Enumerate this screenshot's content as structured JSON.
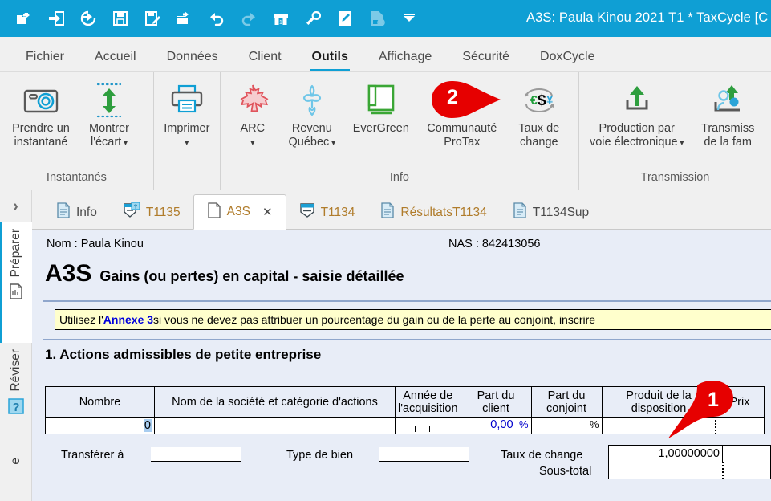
{
  "titlebar": {
    "title": "A3S: Paula Kinou 2021 T1 * TaxCycle [C",
    "quick_access": [
      {
        "name": "open-folder-icon",
        "label": "Ouvrir",
        "disabled": false
      },
      {
        "name": "import-icon",
        "label": "Importer",
        "disabled": false
      },
      {
        "name": "restore-icon",
        "label": "Restaurer",
        "disabled": false
      },
      {
        "name": "save-icon",
        "label": "Enregistrer",
        "disabled": false
      },
      {
        "name": "save-as-icon",
        "label": "Enregistrer sous",
        "disabled": false
      },
      {
        "name": "folder-open-2-icon",
        "label": "Ouvrir dossier",
        "disabled": false
      },
      {
        "name": "undo-icon",
        "label": "Annuler",
        "disabled": false
      },
      {
        "name": "redo-icon",
        "label": "Rétablir",
        "disabled": true
      },
      {
        "name": "t1-archive-icon",
        "label": "T1",
        "disabled": false
      },
      {
        "name": "wrench-icon",
        "label": "Outils",
        "disabled": false
      },
      {
        "name": "edit-note-icon",
        "label": "Notes",
        "disabled": false
      },
      {
        "name": "tfile-disabled-icon",
        "label": "Fichier T",
        "disabled": true
      },
      {
        "name": "chevron-down-icon",
        "label": "Plus",
        "disabled": false
      }
    ]
  },
  "ribbon_tabs": [
    {
      "label": "Fichier",
      "active": false
    },
    {
      "label": "Accueil",
      "active": false
    },
    {
      "label": "Données",
      "active": false
    },
    {
      "label": "Client",
      "active": false
    },
    {
      "label": "Outils",
      "active": true
    },
    {
      "label": "Affichage",
      "active": false
    },
    {
      "label": "Sécurité",
      "active": false
    },
    {
      "label": "DoxCycle",
      "active": false
    }
  ],
  "ribbon_groups": [
    {
      "label": "Instantanés",
      "buttons": [
        {
          "icon": "camera-icon",
          "label": "Prendre un\ninstantané",
          "caret": false
        },
        {
          "icon": "variance-arrows-icon",
          "label": "Montrer\nl'écart",
          "caret": true
        }
      ]
    },
    {
      "label": "",
      "buttons": [
        {
          "icon": "printer-icon",
          "label": "Imprimer",
          "caret": true
        }
      ]
    },
    {
      "label": "Info",
      "buttons": [
        {
          "icon": "maple-leaf-icon",
          "label": "ARC",
          "caret": true
        },
        {
          "icon": "fleur-de-lys-icon",
          "label": "Revenu\nQuébec",
          "caret": true
        },
        {
          "icon": "green-book-icon",
          "label": "EverGreen",
          "caret": false
        },
        {
          "icon": "community-icon",
          "label": "Communauté\nProTax",
          "caret": false
        },
        {
          "icon": "currency-exchange-icon",
          "label": "Taux de\nchange",
          "caret": false
        }
      ]
    },
    {
      "label": "Transmission",
      "buttons": [
        {
          "icon": "upload-icon",
          "label": "Production par\nvoie électronique",
          "caret": true
        },
        {
          "icon": "family-upload-icon",
          "label": "Transmiss\nde la fam",
          "caret": false
        }
      ]
    }
  ],
  "markers": [
    {
      "number": "1",
      "color": "#e60000"
    },
    {
      "number": "2",
      "color": "#e60000"
    }
  ],
  "leftnav": {
    "expand_chevron": "›",
    "items": [
      {
        "label": "Préparer",
        "icon": "form-page-icon",
        "active": true
      },
      {
        "label": "Réviser",
        "icon": "question-mark-icon",
        "active": false
      },
      {
        "label": "e",
        "icon": "",
        "active": false
      }
    ]
  },
  "doc_tabs": [
    {
      "label": "Info",
      "icon": "document-lines-icon",
      "active": false,
      "closable": false
    },
    {
      "label": "T1135",
      "icon": "slip-question-icon",
      "active": false,
      "closable": false
    },
    {
      "label": "A3S",
      "icon": "blank-page-icon",
      "active": true,
      "closable": true
    },
    {
      "label": "T1134",
      "icon": "slip-icon",
      "active": false,
      "closable": false
    },
    {
      "label": "RésultatsT1134",
      "icon": "document-lines-icon",
      "active": false,
      "closable": false
    },
    {
      "label": "T1134Sup",
      "icon": "document-lines-icon",
      "active": false,
      "closable": false
    }
  ],
  "form": {
    "nom_label": "Nom : Paula Kinou",
    "nas_label": "NAS : 842413056",
    "form_code": "A3S",
    "form_title": "Gains (ou pertes) en capital - saisie détaillée",
    "note_prefix": "Utilisez l'",
    "note_link": "Annexe 3",
    "note_suffix": " si vous ne devez pas attribuer un pourcentage du gain ou de la perte au conjoint, inscrire",
    "section_title": "1. Actions admissibles de petite entreprise",
    "table": {
      "headers": [
        "Nombre",
        "Nom de la société et catégorie d'actions",
        "Année de\nl'acquisition",
        "Part du\nclient",
        "Part du\nconjoint",
        "Produit de la\ndisposition",
        "Prix"
      ],
      "row": {
        "nombre": "0",
        "societe": "",
        "annee": "",
        "part_client": "0,00",
        "part_client_unit": "%",
        "part_conjoint": "",
        "part_conjoint_unit": "%",
        "produit": "",
        "prix": ""
      }
    },
    "transferer_label": "Transférer à",
    "transferer_value": "",
    "type_bien_label": "Type de bien",
    "type_bien_value": "",
    "taux_change_label": "Taux de change",
    "taux_change_value": "1,00000000",
    "sous_total_label": "Sous-total",
    "sous_total_value": ""
  },
  "colors": {
    "accent": "#0f9fd4",
    "form_bg": "#e8edf7",
    "note_bg": "#ffffcc",
    "marker": "#e60000",
    "link": "#0000dd"
  }
}
